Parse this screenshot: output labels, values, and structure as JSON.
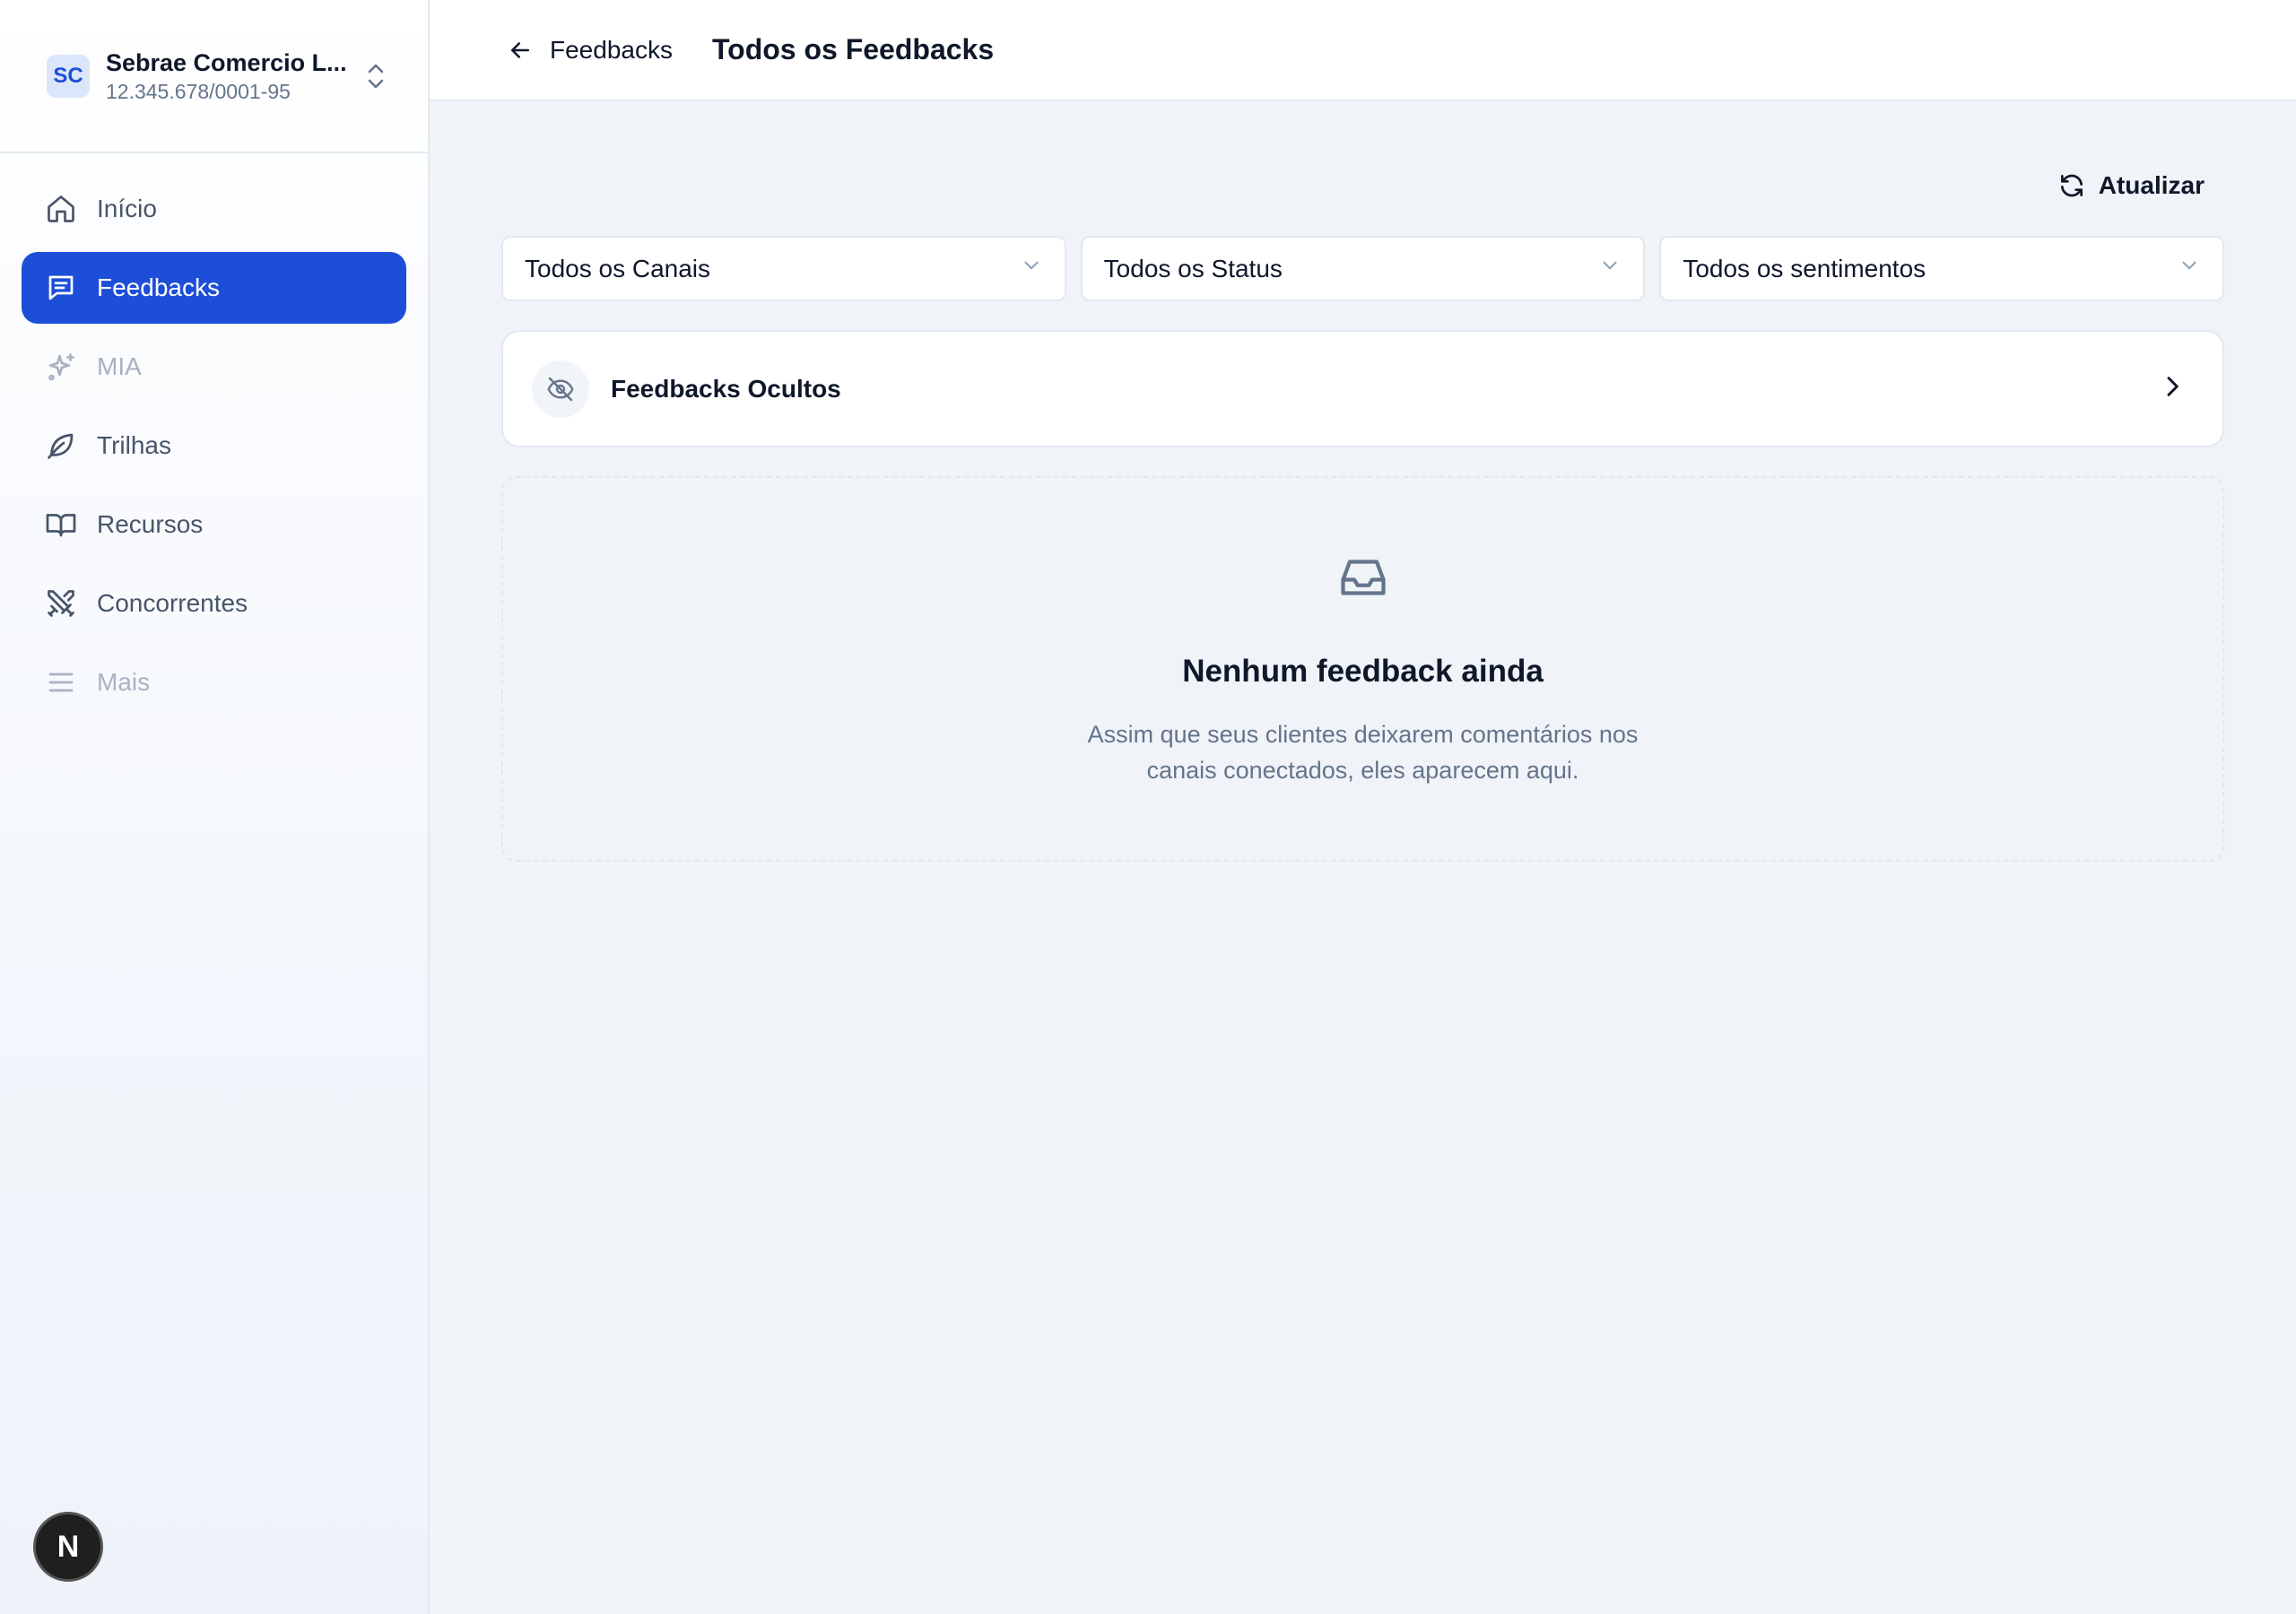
{
  "org": {
    "initials": "SC",
    "name": "Sebrae Comercio L...",
    "cnpj": "12.345.678/0001-95"
  },
  "nav": {
    "items": [
      {
        "label": "Início",
        "icon": "home-icon"
      },
      {
        "label": "Feedbacks",
        "icon": "message-square-text-icon"
      },
      {
        "label": "MIA",
        "icon": "sparkles-icon"
      },
      {
        "label": "Trilhas",
        "icon": "leaf-icon"
      },
      {
        "label": "Recursos",
        "icon": "book-open-icon"
      },
      {
        "label": "Concorrentes",
        "icon": "swords-icon"
      },
      {
        "label": "Mais",
        "icon": "menu-icon"
      }
    ]
  },
  "header": {
    "back_label": "Feedbacks",
    "title": "Todos os Feedbacks"
  },
  "toolbar": {
    "refresh_label": "Atualizar"
  },
  "filters": {
    "channels": "Todos os Canais",
    "status": "Todos os Status",
    "sentiment": "Todos os sentimentos"
  },
  "hidden": {
    "label": "Feedbacks Ocultos"
  },
  "empty": {
    "title": "Nenhum feedback ainda",
    "description": "Assim que seus clientes deixarem comentários nos canais conectados, eles aparecem aqui."
  },
  "dev_badge": {
    "letter": "N"
  },
  "colors": {
    "accent": "#1d4ed8",
    "background": "#f0f3f8",
    "muted_text": "#64748b"
  }
}
